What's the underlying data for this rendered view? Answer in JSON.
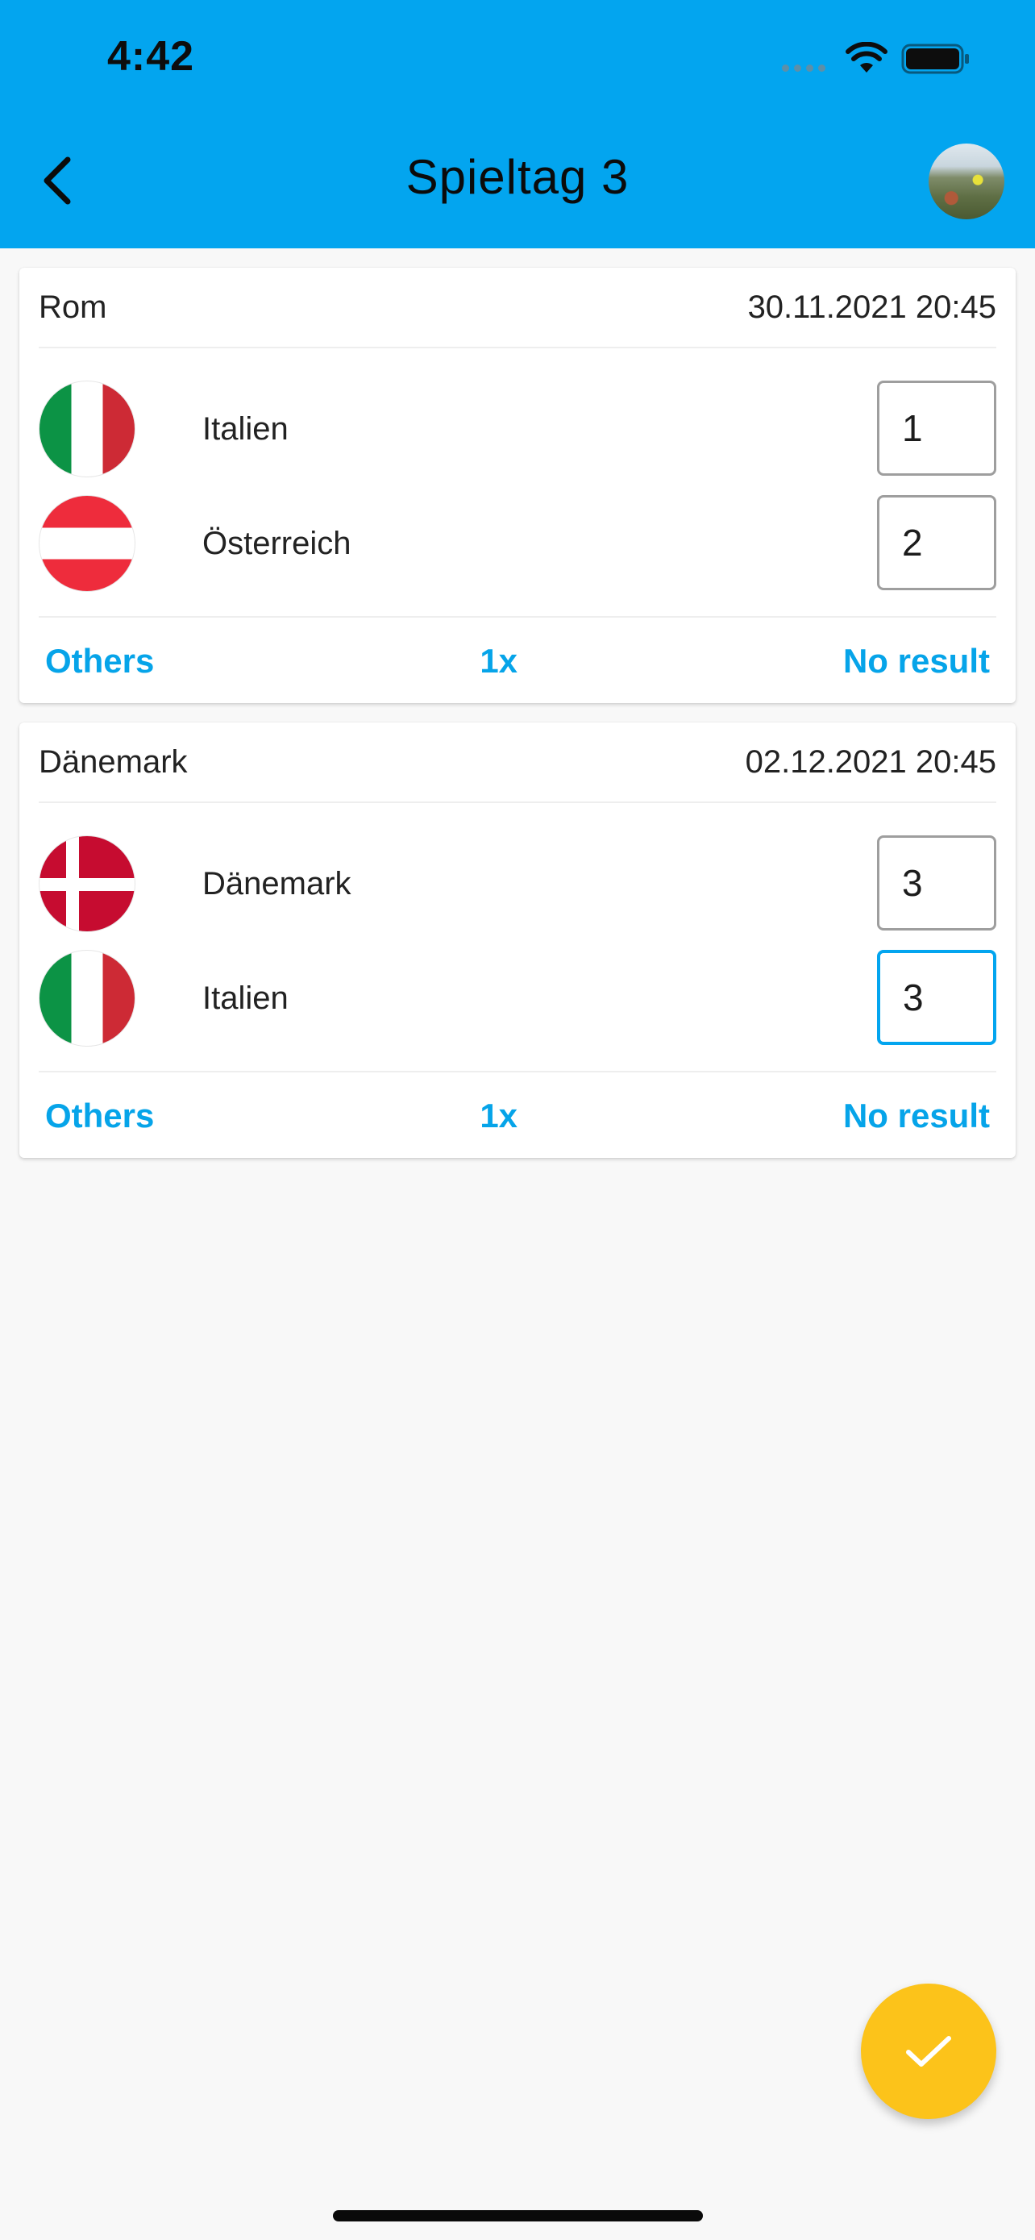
{
  "status_bar": {
    "time": "4:42"
  },
  "header": {
    "title": "Spieltag 3"
  },
  "matches": [
    {
      "location": "Rom",
      "datetime": "30.11.2021 20:45",
      "teams": [
        {
          "name": "Italien",
          "flag": "italy-flag-icon",
          "score": "1"
        },
        {
          "name": "Österreich",
          "flag": "austria-flag-icon",
          "score": "2"
        }
      ],
      "actions": {
        "others": "Others",
        "multiplier": "1x",
        "no_result": "No result"
      }
    },
    {
      "location": "Dänemark",
      "datetime": "02.12.2021 20:45",
      "teams": [
        {
          "name": "Dänemark",
          "flag": "denmark-flag-icon",
          "score": "3"
        },
        {
          "name": "Italien",
          "flag": "italy-flag-icon",
          "score": "3"
        }
      ],
      "actions": {
        "others": "Others",
        "multiplier": "1x",
        "no_result": "No result"
      }
    }
  ],
  "colors": {
    "primary": "#03a5ef",
    "accent_text": "#06a4e9",
    "fab": "#fcc31a",
    "background": "#f8f8f8"
  },
  "icons": {
    "back": "chevron-left-icon",
    "fab": "check-icon",
    "wifi": "wifi-icon",
    "battery": "battery-icon"
  }
}
